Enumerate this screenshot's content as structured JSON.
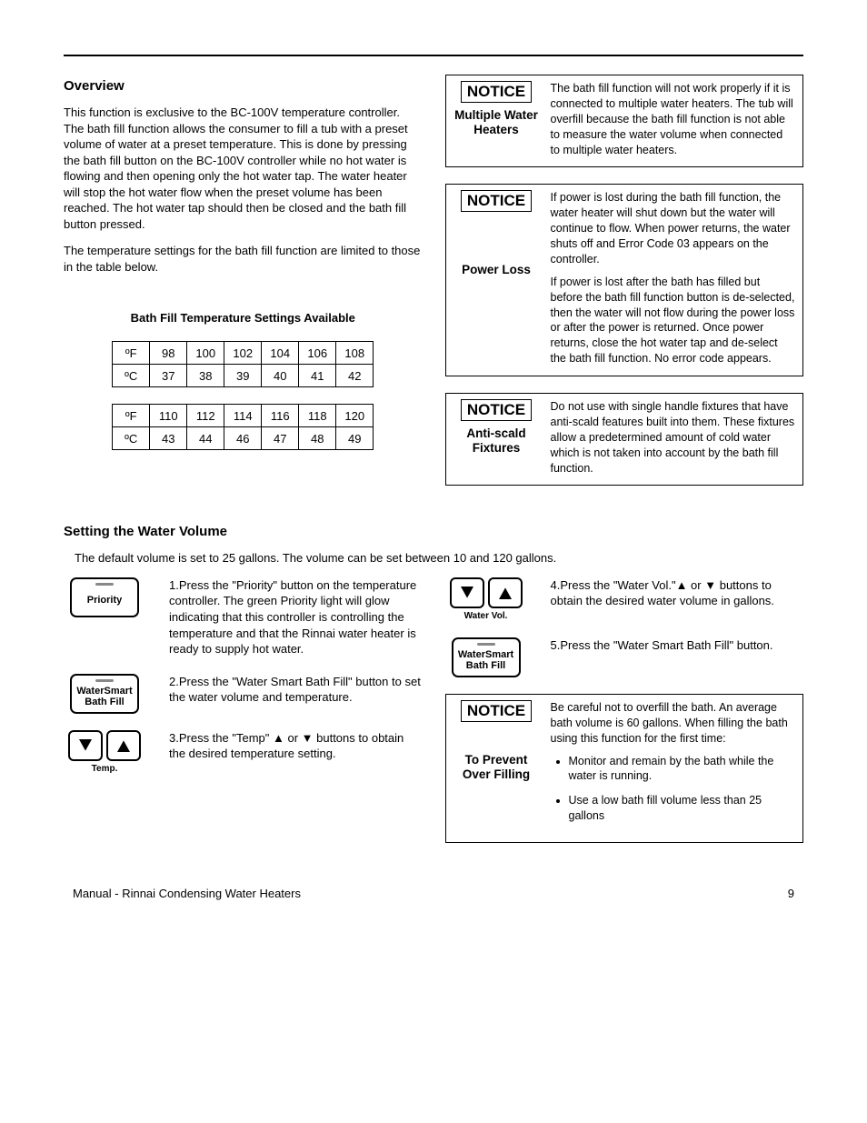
{
  "headings": {
    "overview": "Overview",
    "settingVolume": "Setting the Water Volume",
    "tableTitle": "Bath Fill Temperature Settings Available"
  },
  "overview": {
    "p1": "This function is exclusive to the BC-100V temperature controller.  The bath fill function allows the consumer to fill a tub with a preset volume of water at a preset temperature.  This is done by pressing the bath fill button on the BC-100V controller while no hot water is flowing and then opening only the hot water tap.  The water heater will stop the hot water flow when the preset volume has been reached.  The hot water tap should then be closed and the bath fill button pressed.",
    "p2": "The temperature settings for the bath fill function are limited to those in the table below."
  },
  "tempTable1": {
    "rowF": [
      "ºF",
      "98",
      "100",
      "102",
      "104",
      "106",
      "108"
    ],
    "rowC": [
      "ºC",
      "37",
      "38",
      "39",
      "40",
      "41",
      "42"
    ]
  },
  "tempTable2": {
    "rowF": [
      "ºF",
      "110",
      "112",
      "114",
      "116",
      "118",
      "120"
    ],
    "rowC": [
      "ºC",
      "43",
      "44",
      "46",
      "47",
      "48",
      "49"
    ]
  },
  "notices": {
    "tag": "NOTICE",
    "multiple": {
      "title": "Multiple Water Heaters",
      "body": "The bath fill function will not work properly if it is connected to multiple water heaters.  The tub will overfill because the bath fill function is not able to measure the water volume when connected to multiple water heaters."
    },
    "power": {
      "title": "Power Loss",
      "p1": "If power is lost during the bath fill function, the water heater will shut down but the water will continue to flow.  When power returns, the water shuts off and Error Code 03 appears on the controller.",
      "p2": "If power is lost after the bath has filled but before the bath fill function button is de-selected, then the water will not flow during the power loss or after the power is returned.  Once power returns, close the hot water tap and de-select the bath fill function.  No error code appears."
    },
    "antiscald": {
      "title": "Anti-scald Fixtures",
      "body": "Do not use with single handle fixtures that have anti-scald features built into them.  These fixtures allow a predetermined amount of cold water which is not taken into account by the bath fill function."
    },
    "prevent": {
      "title": "To Prevent Over Filling",
      "intro": "Be careful not to overfill the bath.  An average bath volume is 60 gallons.  When filling the bath using this function for the first time:",
      "b1": "Monitor and remain by the bath while the water is running.",
      "b2": "Use a low bath fill volume less than 25 gallons"
    }
  },
  "volume": {
    "intro": "The default volume is set to 25 gallons.  The volume can be set between 10 and 120 gallons."
  },
  "buttons": {
    "priority": "Priority",
    "bathfillL1": "WaterSmart",
    "bathfillL2": "Bath Fill",
    "tempLabel": "Temp.",
    "waterVolLabel": "Water Vol."
  },
  "steps": {
    "s1": "1.Press the \"Priority\" button on the temperature controller.  The green Priority light will glow indicating that this controller is controlling the temperature and that the Rinnai water heater is ready to supply hot water.",
    "s2": "2.Press the \"Water Smart Bath Fill\" button to set the water volume and temperature.",
    "s3": "3.Press the \"Temp\" ▲ or ▼ buttons to obtain the desired temperature setting.",
    "s4": "4.Press the \"Water Vol.\"▲ or ▼ buttons to obtain the desired water volume in gallons.",
    "s5": "5.Press the \"Water Smart Bath Fill\" button."
  },
  "footer": {
    "left": "Manual - Rinnai Condensing Water Heaters",
    "right": "9"
  },
  "chart_data": [
    {
      "type": "table",
      "title": "Bath Fill Temperature Settings Available (part 1)",
      "rows": [
        {
          "unit": "ºF",
          "values": [
            98,
            100,
            102,
            104,
            106,
            108
          ]
        },
        {
          "unit": "ºC",
          "values": [
            37,
            38,
            39,
            40,
            41,
            42
          ]
        }
      ]
    },
    {
      "type": "table",
      "title": "Bath Fill Temperature Settings Available (part 2)",
      "rows": [
        {
          "unit": "ºF",
          "values": [
            110,
            112,
            114,
            116,
            118,
            120
          ]
        },
        {
          "unit": "ºC",
          "values": [
            43,
            44,
            46,
            47,
            48,
            49
          ]
        }
      ]
    }
  ]
}
